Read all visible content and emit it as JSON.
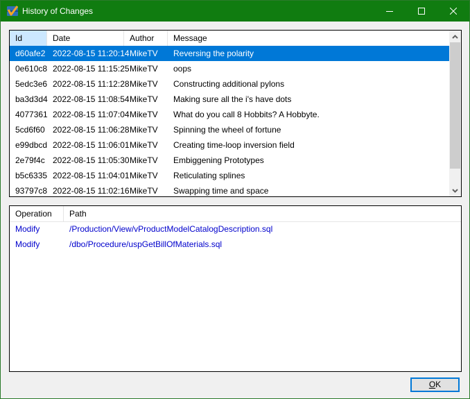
{
  "window": {
    "title": "History of Changes",
    "app_icon": "checkmark-app-icon",
    "controls": {
      "minimize": "minimize-icon",
      "maximize": "maximize-icon",
      "close": "close-icon"
    },
    "accent_color": "#107c10"
  },
  "commits": {
    "columns": [
      "Id",
      "Date",
      "Author",
      "Message"
    ],
    "sorted_column": "Id",
    "selected_index": 0,
    "selection_color": "#0078d7",
    "rows": [
      {
        "id": "d60afe2",
        "date": "2022-08-15 11:20:14",
        "author": "MikeTV",
        "message": "Reversing the polarity"
      },
      {
        "id": "0e610c8",
        "date": "2022-08-15 11:15:25",
        "author": "MikeTV",
        "message": "oops"
      },
      {
        "id": "5edc3e6",
        "date": "2022-08-15 11:12:28",
        "author": "MikeTV",
        "message": "Constructing additional pylons"
      },
      {
        "id": "ba3d3d4",
        "date": "2022-08-15 11:08:54",
        "author": "MikeTV",
        "message": "Making sure all the i's have dots"
      },
      {
        "id": "4077361",
        "date": "2022-08-15 11:07:04",
        "author": "MikeTV",
        "message": "What do you call 8 Hobbits? A Hobbyte."
      },
      {
        "id": "5cd6f60",
        "date": "2022-08-15 11:06:28",
        "author": "MikeTV",
        "message": "Spinning the wheel of fortune"
      },
      {
        "id": "e99dbcd",
        "date": "2022-08-15 11:06:01",
        "author": "MikeTV",
        "message": "Creating time-loop inversion field"
      },
      {
        "id": "2e79f4c",
        "date": "2022-08-15 11:05:30",
        "author": "MikeTV",
        "message": "Embiggening Prototypes"
      },
      {
        "id": "b5c6335",
        "date": "2022-08-15 11:04:01",
        "author": "MikeTV",
        "message": "Reticulating splines"
      },
      {
        "id": "93797c8",
        "date": "2022-08-15 11:02:16",
        "author": "MikeTV",
        "message": "Swapping time and space"
      }
    ]
  },
  "changes": {
    "columns": [
      "Operation",
      "Path"
    ],
    "link_color": "#0000cc",
    "rows": [
      {
        "operation": "Modify",
        "path": "/Production/View/vProductModelCatalogDescription.sql"
      },
      {
        "operation": "Modify",
        "path": "/dbo/Procedure/uspGetBillOfMaterials.sql"
      }
    ]
  },
  "buttons": {
    "ok_mnemonic": "O",
    "ok_rest": "K"
  }
}
